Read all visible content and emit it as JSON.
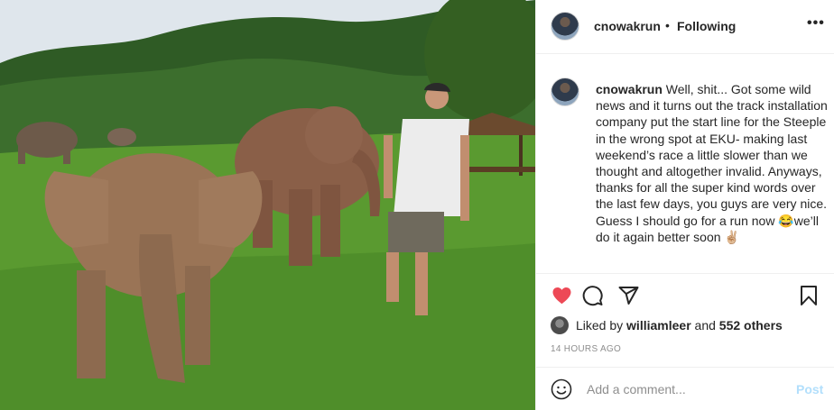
{
  "post": {
    "photo_icon": "photo-elephants-field",
    "header": {
      "username": "cnowakrun",
      "separator": "•",
      "follow_label": "Following",
      "more_label": "•••"
    },
    "caption": {
      "username": "cnowakrun",
      "text": "Well, shit... Got some wild news and it turns out the track installation company put the start line for the Steeple in the wrong spot at EKU- making last weekend’s race a little slower than we thought and altogether invalid. Anyways, thanks for all the super kind words over the last few days, you guys are very nice. Guess I should go for a run now 😂we’ll do it again better soon ✌🏼"
    },
    "actions": {
      "like_icon": "heart-icon",
      "comment_icon": "comment-icon",
      "share_icon": "share-icon",
      "save_icon": "bookmark-icon",
      "like_color": "#ed4956"
    },
    "likes": {
      "prefix": "Liked by",
      "user": "williamleer",
      "middle": "and",
      "others": "552 others"
    },
    "timestamp": "14 HOURS AGO",
    "comment_box": {
      "placeholder": "Add a comment...",
      "post_label": "Post",
      "emoji_icon": "smiley-icon"
    }
  }
}
